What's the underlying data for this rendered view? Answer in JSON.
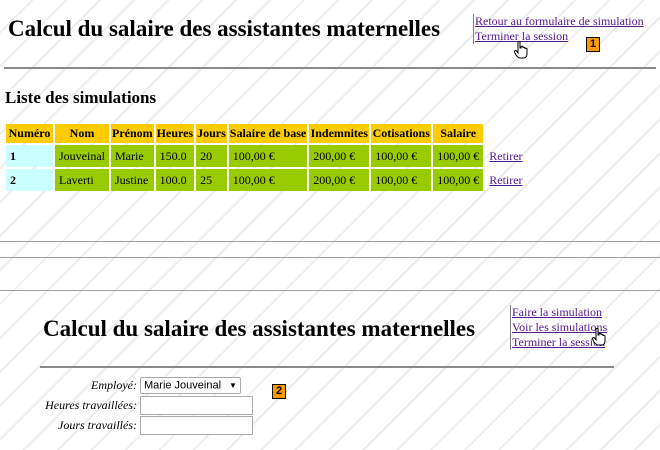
{
  "top": {
    "title": "Calcul du salaire des assistantes maternelles",
    "menu": [
      "Retour au formulaire de simulation",
      "Terminer la session"
    ],
    "badge": "1",
    "list_title": "Liste des simulations"
  },
  "table": {
    "headers": [
      "Numéro",
      "Nom",
      "Prénom",
      "Heures",
      "Jours",
      "Salaire de base",
      "Indemnites",
      "Cotisations",
      "Salaire"
    ],
    "rows": [
      {
        "num": "1",
        "nom": "Jouveinal",
        "prenom": "Marie",
        "heures": "150.0",
        "jours": "20",
        "base": "100,00 €",
        "indemnites": "200,00 €",
        "cotisations": "100,00 €",
        "salaire": "100,00 €",
        "action": "Retirer"
      },
      {
        "num": "2",
        "nom": "Laverti",
        "prenom": "Justine",
        "heures": "100.0",
        "jours": "25",
        "base": "100,00 €",
        "indemnites": "200,00 €",
        "cotisations": "100,00 €",
        "salaire": "100,00 €",
        "action": "Retirer"
      }
    ]
  },
  "bottom": {
    "title": "Calcul du salaire des assistantes maternelles",
    "menu": [
      "Faire la simulation",
      "Voir les simulations",
      "Terminer la session"
    ],
    "badge": "2",
    "form": {
      "employe_label": "Employé:",
      "employe_value": "Marie Jouveinal",
      "heures_label": "Heures travaillées:",
      "heures_value": "",
      "jours_label": "Jours travaillés:",
      "jours_value": ""
    }
  },
  "colors": {
    "header_bg": "#ffcc00",
    "num_bg": "#ccffff",
    "cell_bg": "#99cc00",
    "badge_bg": "#ff9900",
    "link": "#551a8b"
  }
}
